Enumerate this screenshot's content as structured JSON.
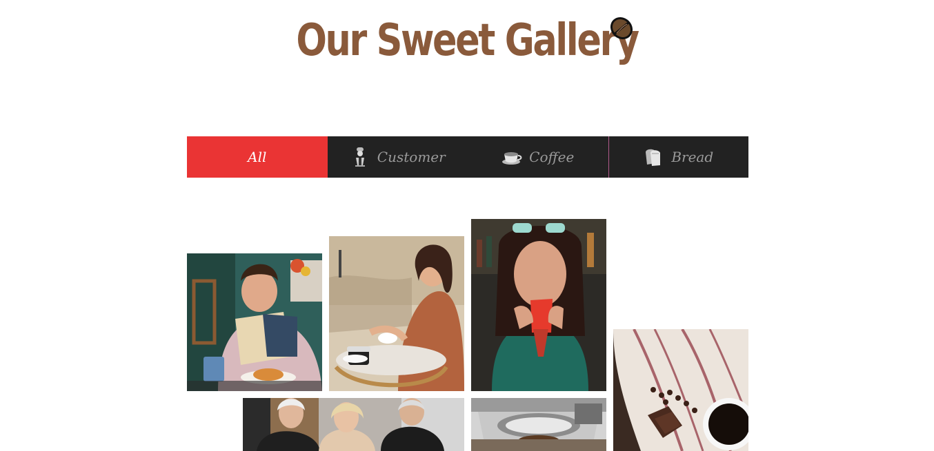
{
  "header": {
    "title": "Our Sweet Gallery",
    "icon": "coffee-bean-icon"
  },
  "filters": {
    "tabs": [
      {
        "label": "All",
        "icon": "",
        "active": true
      },
      {
        "label": "Customer",
        "icon": "barista-icon",
        "active": false
      },
      {
        "label": "Coffee",
        "icon": "coffee-cup-icon",
        "active": false
      },
      {
        "label": "Bread",
        "icon": "bread-icon",
        "active": false
      }
    ]
  },
  "gallery": {
    "items": [
      {
        "category": "Customer",
        "subject": "man reading book with croissant"
      },
      {
        "category": "Customer",
        "subject": "woman smiling at cafe table"
      },
      {
        "category": "Customer",
        "subject": "woman sipping from red cup"
      },
      {
        "category": "Coffee",
        "subject": "coffee beans, chocolate and coffee cup on cloth"
      },
      {
        "category": "Customer",
        "subject": "group of seniors at cafe"
      },
      {
        "category": "Coffee",
        "subject": "espresso machine portafilter"
      }
    ]
  },
  "colors": {
    "title": "#8a5a3b",
    "active_tab": "#ea3434",
    "bar": "#222222",
    "inactive_text": "#9a9a9a"
  }
}
